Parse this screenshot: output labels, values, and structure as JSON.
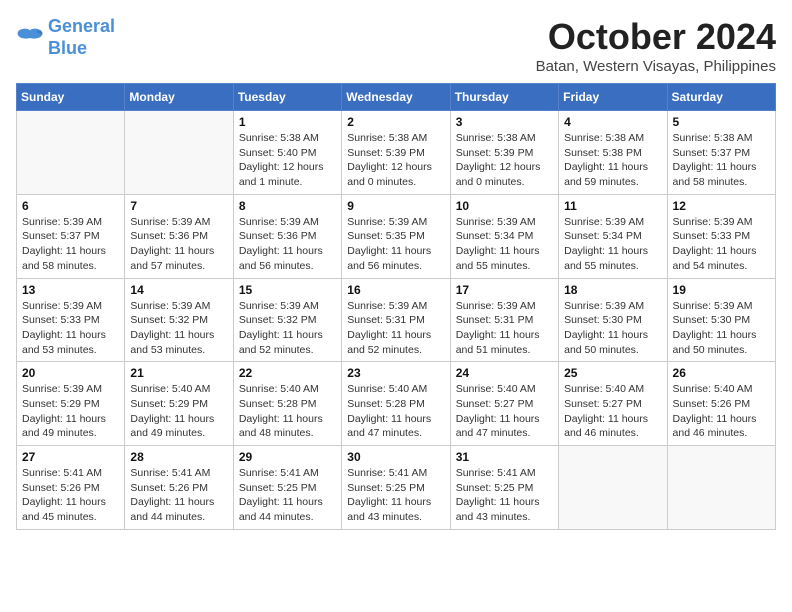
{
  "logo": {
    "line1": "General",
    "line2": "Blue"
  },
  "title": "October 2024",
  "location": "Batan, Western Visayas, Philippines",
  "headers": [
    "Sunday",
    "Monday",
    "Tuesday",
    "Wednesday",
    "Thursday",
    "Friday",
    "Saturday"
  ],
  "weeks": [
    [
      {
        "day": "",
        "info": ""
      },
      {
        "day": "",
        "info": ""
      },
      {
        "day": "1",
        "info": "Sunrise: 5:38 AM\nSunset: 5:40 PM\nDaylight: 12 hours\nand 1 minute."
      },
      {
        "day": "2",
        "info": "Sunrise: 5:38 AM\nSunset: 5:39 PM\nDaylight: 12 hours\nand 0 minutes."
      },
      {
        "day": "3",
        "info": "Sunrise: 5:38 AM\nSunset: 5:39 PM\nDaylight: 12 hours\nand 0 minutes."
      },
      {
        "day": "4",
        "info": "Sunrise: 5:38 AM\nSunset: 5:38 PM\nDaylight: 11 hours\nand 59 minutes."
      },
      {
        "day": "5",
        "info": "Sunrise: 5:38 AM\nSunset: 5:37 PM\nDaylight: 11 hours\nand 58 minutes."
      }
    ],
    [
      {
        "day": "6",
        "info": "Sunrise: 5:39 AM\nSunset: 5:37 PM\nDaylight: 11 hours\nand 58 minutes."
      },
      {
        "day": "7",
        "info": "Sunrise: 5:39 AM\nSunset: 5:36 PM\nDaylight: 11 hours\nand 57 minutes."
      },
      {
        "day": "8",
        "info": "Sunrise: 5:39 AM\nSunset: 5:36 PM\nDaylight: 11 hours\nand 56 minutes."
      },
      {
        "day": "9",
        "info": "Sunrise: 5:39 AM\nSunset: 5:35 PM\nDaylight: 11 hours\nand 56 minutes."
      },
      {
        "day": "10",
        "info": "Sunrise: 5:39 AM\nSunset: 5:34 PM\nDaylight: 11 hours\nand 55 minutes."
      },
      {
        "day": "11",
        "info": "Sunrise: 5:39 AM\nSunset: 5:34 PM\nDaylight: 11 hours\nand 55 minutes."
      },
      {
        "day": "12",
        "info": "Sunrise: 5:39 AM\nSunset: 5:33 PM\nDaylight: 11 hours\nand 54 minutes."
      }
    ],
    [
      {
        "day": "13",
        "info": "Sunrise: 5:39 AM\nSunset: 5:33 PM\nDaylight: 11 hours\nand 53 minutes."
      },
      {
        "day": "14",
        "info": "Sunrise: 5:39 AM\nSunset: 5:32 PM\nDaylight: 11 hours\nand 53 minutes."
      },
      {
        "day": "15",
        "info": "Sunrise: 5:39 AM\nSunset: 5:32 PM\nDaylight: 11 hours\nand 52 minutes."
      },
      {
        "day": "16",
        "info": "Sunrise: 5:39 AM\nSunset: 5:31 PM\nDaylight: 11 hours\nand 52 minutes."
      },
      {
        "day": "17",
        "info": "Sunrise: 5:39 AM\nSunset: 5:31 PM\nDaylight: 11 hours\nand 51 minutes."
      },
      {
        "day": "18",
        "info": "Sunrise: 5:39 AM\nSunset: 5:30 PM\nDaylight: 11 hours\nand 50 minutes."
      },
      {
        "day": "19",
        "info": "Sunrise: 5:39 AM\nSunset: 5:30 PM\nDaylight: 11 hours\nand 50 minutes."
      }
    ],
    [
      {
        "day": "20",
        "info": "Sunrise: 5:39 AM\nSunset: 5:29 PM\nDaylight: 11 hours\nand 49 minutes."
      },
      {
        "day": "21",
        "info": "Sunrise: 5:40 AM\nSunset: 5:29 PM\nDaylight: 11 hours\nand 49 minutes."
      },
      {
        "day": "22",
        "info": "Sunrise: 5:40 AM\nSunset: 5:28 PM\nDaylight: 11 hours\nand 48 minutes."
      },
      {
        "day": "23",
        "info": "Sunrise: 5:40 AM\nSunset: 5:28 PM\nDaylight: 11 hours\nand 47 minutes."
      },
      {
        "day": "24",
        "info": "Sunrise: 5:40 AM\nSunset: 5:27 PM\nDaylight: 11 hours\nand 47 minutes."
      },
      {
        "day": "25",
        "info": "Sunrise: 5:40 AM\nSunset: 5:27 PM\nDaylight: 11 hours\nand 46 minutes."
      },
      {
        "day": "26",
        "info": "Sunrise: 5:40 AM\nSunset: 5:26 PM\nDaylight: 11 hours\nand 46 minutes."
      }
    ],
    [
      {
        "day": "27",
        "info": "Sunrise: 5:41 AM\nSunset: 5:26 PM\nDaylight: 11 hours\nand 45 minutes."
      },
      {
        "day": "28",
        "info": "Sunrise: 5:41 AM\nSunset: 5:26 PM\nDaylight: 11 hours\nand 44 minutes."
      },
      {
        "day": "29",
        "info": "Sunrise: 5:41 AM\nSunset: 5:25 PM\nDaylight: 11 hours\nand 44 minutes."
      },
      {
        "day": "30",
        "info": "Sunrise: 5:41 AM\nSunset: 5:25 PM\nDaylight: 11 hours\nand 43 minutes."
      },
      {
        "day": "31",
        "info": "Sunrise: 5:41 AM\nSunset: 5:25 PM\nDaylight: 11 hours\nand 43 minutes."
      },
      {
        "day": "",
        "info": ""
      },
      {
        "day": "",
        "info": ""
      }
    ]
  ]
}
